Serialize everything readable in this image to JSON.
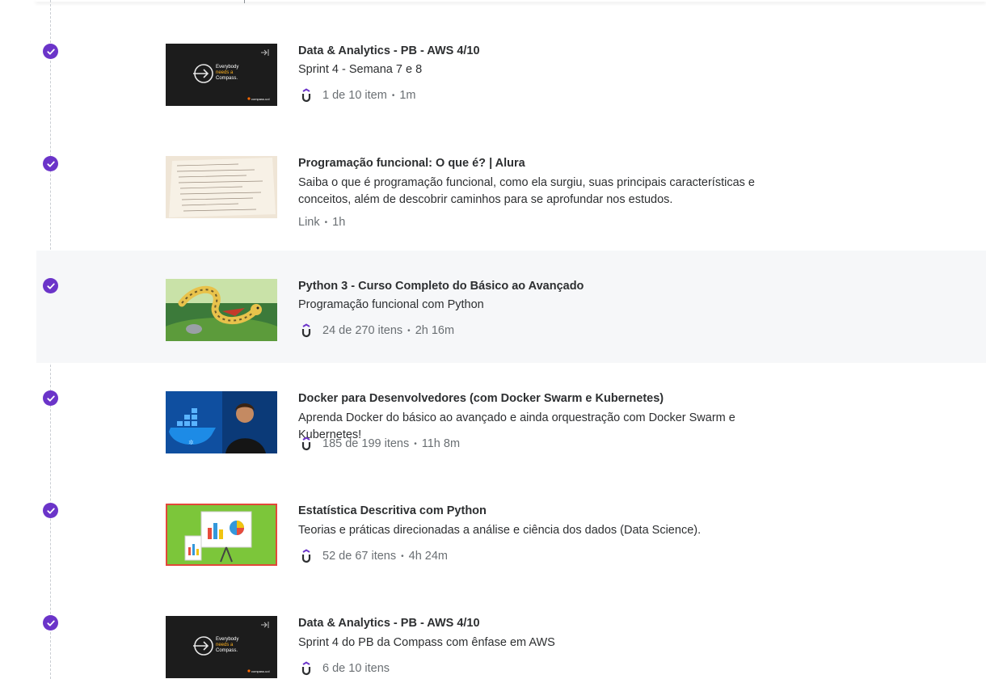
{
  "icons": {
    "completed": "check-circle-icon",
    "provider": "udemy-u-icon"
  },
  "colors": {
    "accent": "#6b34c9",
    "highlight_row": "#f6f7f9",
    "muted_text": "#6a6f73"
  },
  "items": [
    {
      "title": "Data & Analytics - PB - AWS 4/10",
      "description": "Sprint 4 - Semana 7 e 8",
      "meta_type": "1 de 10 item",
      "meta_duration": "1m",
      "thumbnail": "compass-dark",
      "thumb_text": "Everybody needs a Compass.",
      "thumb_brand": "compass.uol"
    },
    {
      "title": "Programação funcional: O que é? | Alura",
      "description": "Saiba o que é programação funcional, como ela surgiu, suas principais características e conceitos, além de descobrir caminhos para se aprofundar nos estudos.",
      "meta_type": "Link",
      "meta_duration": "1h",
      "thumbnail": "paper-notes"
    },
    {
      "title": "Python 3 - Curso Completo do Básico ao Avançado",
      "description": "Programação funcional com Python",
      "meta_type": "24 de 270 itens",
      "meta_duration": "2h 16m",
      "thumbnail": "python-snake"
    },
    {
      "title": "Docker para Desenvolvedores (com Docker Swarm e Kubernetes)",
      "description": "Aprenda Docker do básico ao avançado e ainda orquestração com Docker Swarm e Kubernetes!",
      "meta_type": "185 de 199 itens",
      "meta_duration": "11h 8m",
      "thumbnail": "docker-whale"
    },
    {
      "title": "Estatística Descritiva com Python",
      "description": "Teorias e práticas direcionadas a análise e ciência dos dados (Data Science).",
      "meta_type": "52 de 67 itens",
      "meta_duration": "4h 24m",
      "thumbnail": "stats-board"
    },
    {
      "title": "Data & Analytics - PB - AWS 4/10",
      "description": "Sprint 4 do PB da Compass com ênfase em AWS",
      "meta_type": "6 de 10 itens",
      "meta_duration": "",
      "thumbnail": "compass-dark",
      "thumb_text": "Everybody needs a Compass.",
      "thumb_brand": "compass.uol"
    }
  ]
}
